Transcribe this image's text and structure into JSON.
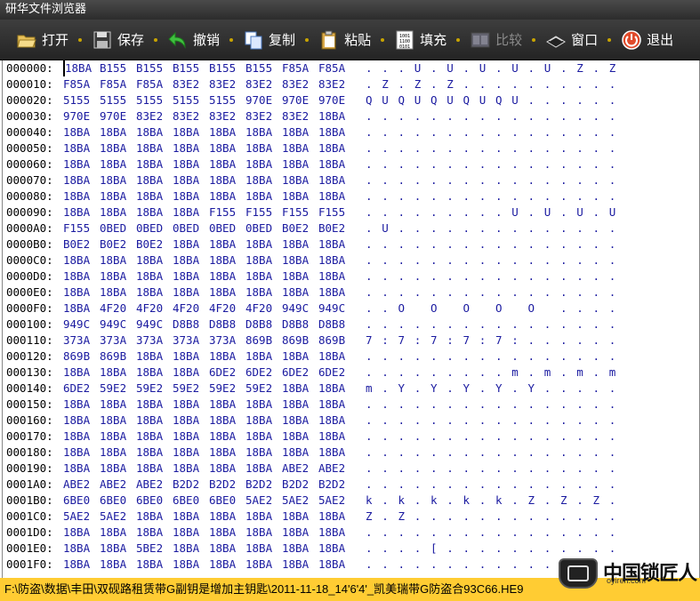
{
  "window": {
    "title": "研华文件浏览器"
  },
  "toolbar": {
    "buttons": [
      {
        "id": "open",
        "label": "打开",
        "icon": "open-folder-icon",
        "enabled": true
      },
      {
        "id": "save",
        "label": "保存",
        "icon": "floppy-disk-icon",
        "enabled": true
      },
      {
        "id": "undo",
        "label": "撤销",
        "icon": "undo-arrow-icon",
        "enabled": true
      },
      {
        "id": "copy",
        "label": "复制",
        "icon": "copy-icon",
        "enabled": true
      },
      {
        "id": "paste",
        "label": "粘贴",
        "icon": "paste-clipboard-icon",
        "enabled": true
      },
      {
        "id": "fill",
        "label": "填充",
        "icon": "binary-fill-icon",
        "enabled": true
      },
      {
        "id": "compare",
        "label": "比较",
        "icon": "compare-icon",
        "enabled": false
      },
      {
        "id": "window",
        "label": "窗口",
        "icon": "chip-window-icon",
        "enabled": true
      },
      {
        "id": "exit",
        "label": "退出",
        "icon": "exit-power-icon",
        "enabled": true
      }
    ]
  },
  "hex_rows": [
    {
      "addr": "000000:",
      "words": [
        "18BA",
        "B155",
        "B155",
        "B155",
        "B155",
        "B155",
        "F85A",
        "F85A"
      ],
      "ascii": ". . . U . U . U . U . U . Z . Z"
    },
    {
      "addr": "000010:",
      "words": [
        "F85A",
        "F85A",
        "F85A",
        "83E2",
        "83E2",
        "83E2",
        "83E2",
        "83E2"
      ],
      "ascii": ". Z . Z . Z . . . . . . . . . ."
    },
    {
      "addr": "000020:",
      "words": [
        "5155",
        "5155",
        "5155",
        "5155",
        "5155",
        "970E",
        "970E",
        "970E"
      ],
      "ascii": "Q U Q U Q U Q U Q U . . . . . ."
    },
    {
      "addr": "000030:",
      "words": [
        "970E",
        "970E",
        "83E2",
        "83E2",
        "83E2",
        "83E2",
        "83E2",
        "18BA"
      ],
      "ascii": ". . . . . . . . . . . . . . . ."
    },
    {
      "addr": "000040:",
      "words": [
        "18BA",
        "18BA",
        "18BA",
        "18BA",
        "18BA",
        "18BA",
        "18BA",
        "18BA"
      ],
      "ascii": ". . . . . . . . . . . . . . . ."
    },
    {
      "addr": "000050:",
      "words": [
        "18BA",
        "18BA",
        "18BA",
        "18BA",
        "18BA",
        "18BA",
        "18BA",
        "18BA"
      ],
      "ascii": ". . . . . . . . . . . . . . . ."
    },
    {
      "addr": "000060:",
      "words": [
        "18BA",
        "18BA",
        "18BA",
        "18BA",
        "18BA",
        "18BA",
        "18BA",
        "18BA"
      ],
      "ascii": ". . . . . . . . . . . . . . . ."
    },
    {
      "addr": "000070:",
      "words": [
        "18BA",
        "18BA",
        "18BA",
        "18BA",
        "18BA",
        "18BA",
        "18BA",
        "18BA"
      ],
      "ascii": ". . . . . . . . . . . . . . . ."
    },
    {
      "addr": "000080:",
      "words": [
        "18BA",
        "18BA",
        "18BA",
        "18BA",
        "18BA",
        "18BA",
        "18BA",
        "18BA"
      ],
      "ascii": ". . . . . . . . . . . . . . . ."
    },
    {
      "addr": "000090:",
      "words": [
        "18BA",
        "18BA",
        "18BA",
        "18BA",
        "F155",
        "F155",
        "F155",
        "F155"
      ],
      "ascii": ". . . . . . . . . U . U . U . U"
    },
    {
      "addr": "0000A0:",
      "words": [
        "F155",
        "0BED",
        "0BED",
        "0BED",
        "0BED",
        "0BED",
        "B0E2",
        "B0E2"
      ],
      "ascii": ". U . . . . . . . . . . . . . ."
    },
    {
      "addr": "0000B0:",
      "words": [
        "B0E2",
        "B0E2",
        "B0E2",
        "18BA",
        "18BA",
        "18BA",
        "18BA",
        "18BA"
      ],
      "ascii": ". . . . . . . . . . . . . . . ."
    },
    {
      "addr": "0000C0:",
      "words": [
        "18BA",
        "18BA",
        "18BA",
        "18BA",
        "18BA",
        "18BA",
        "18BA",
        "18BA"
      ],
      "ascii": ". . . . . . . . . . . . . . . ."
    },
    {
      "addr": "0000D0:",
      "words": [
        "18BA",
        "18BA",
        "18BA",
        "18BA",
        "18BA",
        "18BA",
        "18BA",
        "18BA"
      ],
      "ascii": ". . . . . . . . . . . . . . . ."
    },
    {
      "addr": "0000E0:",
      "words": [
        "18BA",
        "18BA",
        "18BA",
        "18BA",
        "18BA",
        "18BA",
        "18BA",
        "18BA"
      ],
      "ascii": ". . . . . . . . . . . . . . . ."
    },
    {
      "addr": "0000F0:",
      "words": [
        "18BA",
        "4F20",
        "4F20",
        "4F20",
        "4F20",
        "4F20",
        "949C",
        "949C"
      ],
      "ascii": ". . O   O   O   O   O   . . . ."
    },
    {
      "addr": "000100:",
      "words": [
        "949C",
        "949C",
        "949C",
        "D8B8",
        "D8B8",
        "D8B8",
        "D8B8",
        "D8B8"
      ],
      "ascii": ". . . . . . . . . . . . . . . ."
    },
    {
      "addr": "000110:",
      "words": [
        "373A",
        "373A",
        "373A",
        "373A",
        "373A",
        "869B",
        "869B",
        "869B"
      ],
      "ascii": "7 : 7 : 7 : 7 : 7 : . . . . . ."
    },
    {
      "addr": "000120:",
      "words": [
        "869B",
        "869B",
        "18BA",
        "18BA",
        "18BA",
        "18BA",
        "18BA",
        "18BA"
      ],
      "ascii": ". . . . . . . . . . . . . . . ."
    },
    {
      "addr": "000130:",
      "words": [
        "18BA",
        "18BA",
        "18BA",
        "18BA",
        "6DE2",
        "6DE2",
        "6DE2",
        "6DE2"
      ],
      "ascii": ". . . . . . . . . m . m . m . m"
    },
    {
      "addr": "000140:",
      "words": [
        "6DE2",
        "59E2",
        "59E2",
        "59E2",
        "59E2",
        "59E2",
        "18BA",
        "18BA"
      ],
      "ascii": "m . Y . Y . Y . Y . Y . . . . ."
    },
    {
      "addr": "000150:",
      "words": [
        "18BA",
        "18BA",
        "18BA",
        "18BA",
        "18BA",
        "18BA",
        "18BA",
        "18BA"
      ],
      "ascii": ". . . . . . . . . . . . . . . ."
    },
    {
      "addr": "000160:",
      "words": [
        "18BA",
        "18BA",
        "18BA",
        "18BA",
        "18BA",
        "18BA",
        "18BA",
        "18BA"
      ],
      "ascii": ". . . . . . . . . . . . . . . ."
    },
    {
      "addr": "000170:",
      "words": [
        "18BA",
        "18BA",
        "18BA",
        "18BA",
        "18BA",
        "18BA",
        "18BA",
        "18BA"
      ],
      "ascii": ". . . . . . . . . . . . . . . ."
    },
    {
      "addr": "000180:",
      "words": [
        "18BA",
        "18BA",
        "18BA",
        "18BA",
        "18BA",
        "18BA",
        "18BA",
        "18BA"
      ],
      "ascii": ". . . . . . . . . . . . . . . ."
    },
    {
      "addr": "000190:",
      "words": [
        "18BA",
        "18BA",
        "18BA",
        "18BA",
        "18BA",
        "18BA",
        "ABE2",
        "ABE2"
      ],
      "ascii": ". . . . . . . . . . . . . . . ."
    },
    {
      "addr": "0001A0:",
      "words": [
        "ABE2",
        "ABE2",
        "ABE2",
        "B2D2",
        "B2D2",
        "B2D2",
        "B2D2",
        "B2D2"
      ],
      "ascii": ". . . . . . . . . . . . . . . ."
    },
    {
      "addr": "0001B0:",
      "words": [
        "6BE0",
        "6BE0",
        "6BE0",
        "6BE0",
        "6BE0",
        "5AE2",
        "5AE2",
        "5AE2"
      ],
      "ascii": "k . k . k . k . k . Z . Z . Z ."
    },
    {
      "addr": "0001C0:",
      "words": [
        "5AE2",
        "5AE2",
        "18BA",
        "18BA",
        "18BA",
        "18BA",
        "18BA",
        "18BA"
      ],
      "ascii": "Z . Z . . . . . . . . . . . . ."
    },
    {
      "addr": "0001D0:",
      "words": [
        "18BA",
        "18BA",
        "18BA",
        "18BA",
        "18BA",
        "18BA",
        "18BA",
        "18BA"
      ],
      "ascii": ". . . . . . . . . . . . . . . ."
    },
    {
      "addr": "0001E0:",
      "words": [
        "18BA",
        "18BA",
        "5BE2",
        "18BA",
        "18BA",
        "18BA",
        "18BA",
        "18BA"
      ],
      "ascii": ". . . . [ . . . . . . . . . . ."
    },
    {
      "addr": "0001F0:",
      "words": [
        "18BA",
        "18BA",
        "18BA",
        "18BA",
        "18BA",
        "18BA",
        "18BA",
        "18BA"
      ],
      "ascii": ". . . . . . . . . . . . . . . ."
    }
  ],
  "status": {
    "path": "F:\\防盗\\数据\\丰田\\双砚路租赁带G副钥是增加主钥匙\\2011-11-18_14'6'4'_凯美瑞带G防盗合93C66.HE9"
  },
  "watermark": {
    "text": "中国锁匠人",
    "url": "oyiren.com"
  },
  "colors": {
    "hex_blue": "#1a1aa0",
    "status_bg": "#ffcc33",
    "toolbar_bg": "#2c2c2c"
  }
}
